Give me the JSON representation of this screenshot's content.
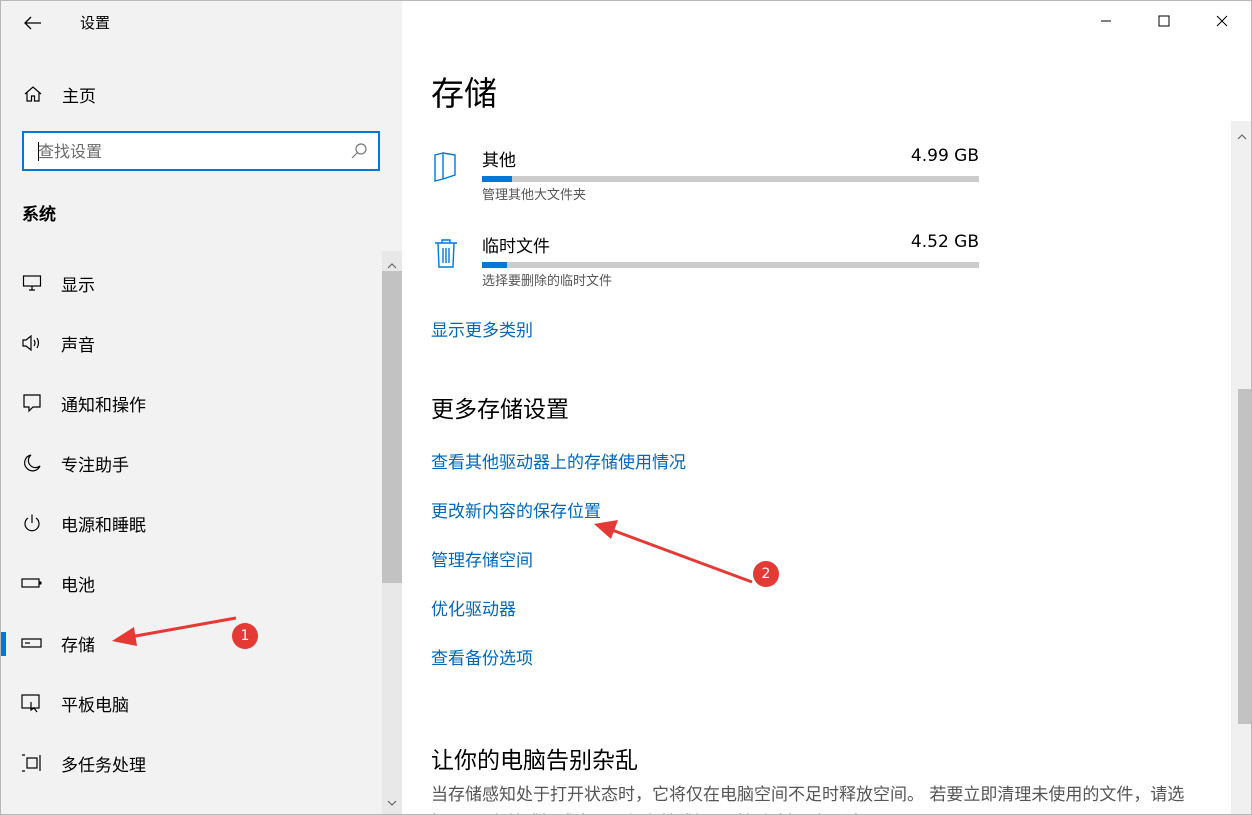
{
  "app": {
    "title": "设置"
  },
  "sidebar": {
    "home_label": "主页",
    "search": {
      "placeholder": "查找设置"
    },
    "section": "系统",
    "items": [
      {
        "label": "显示",
        "icon": "monitor-icon"
      },
      {
        "label": "声音",
        "icon": "speaker-icon"
      },
      {
        "label": "通知和操作",
        "icon": "notification-icon"
      },
      {
        "label": "专注助手",
        "icon": "moon-icon"
      },
      {
        "label": "电源和睡眠",
        "icon": "power-icon"
      },
      {
        "label": "电池",
        "icon": "battery-icon"
      },
      {
        "label": "存储",
        "icon": "storage-icon",
        "active": true
      },
      {
        "label": "平板电脑",
        "icon": "tablet-icon"
      },
      {
        "label": "多任务处理",
        "icon": "multitask-icon"
      }
    ]
  },
  "main": {
    "title": "存储",
    "storage_items": [
      {
        "name": "其他",
        "size": "4.99 GB",
        "desc": "管理其他大文件夹",
        "icon": "folder-icon",
        "fill_fraction": 0.06
      },
      {
        "name": "临时文件",
        "size": "4.52 GB",
        "desc": "选择要删除的临时文件",
        "icon": "trash-icon",
        "fill_fraction": 0.05
      }
    ],
    "show_more": "显示更多类别",
    "more_settings": {
      "heading": "更多存储设置",
      "links": [
        "查看其他驱动器上的存储使用情况",
        "更改新内容的保存位置",
        "管理存储空间",
        "优化驱动器",
        "查看备份选项"
      ]
    },
    "declutter": {
      "heading": "让你的电脑告别杂乱",
      "text": "当存储感知处于打开状态时，它将仅在电脑空间不足时释放空间。 若要立即清理未使用的文件，请选择\"配置存储感知或立即运行存储感知\"，然后选择\"立即清理\"。"
    }
  },
  "annotations": {
    "badge1": "1",
    "badge2": "2",
    "color": "#e53935"
  },
  "colors": {
    "accent": "#0078d7",
    "link": "#0067b8"
  }
}
